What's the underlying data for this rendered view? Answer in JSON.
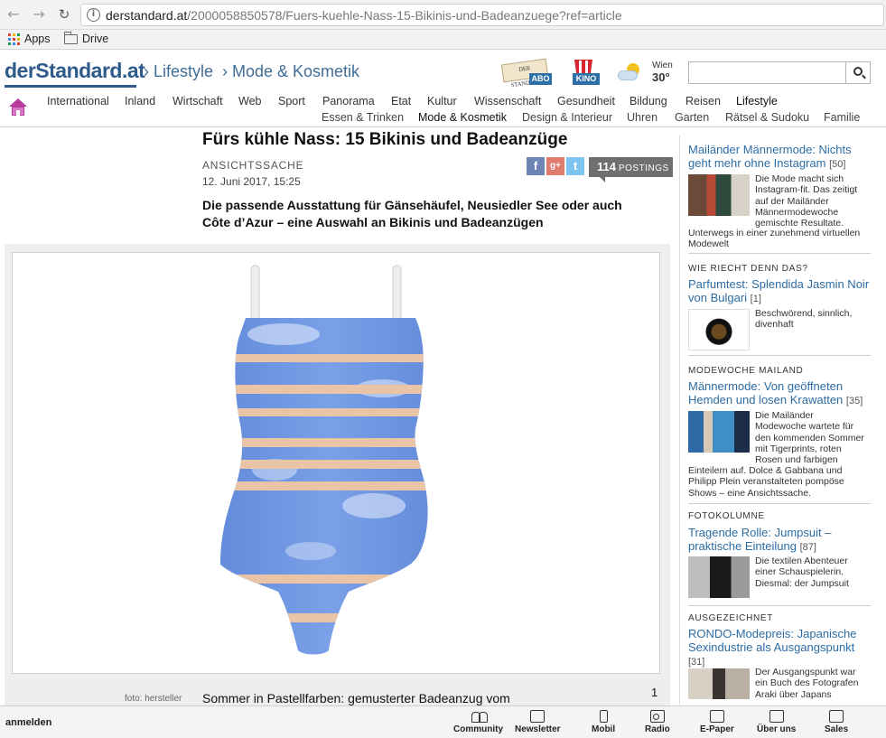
{
  "browser": {
    "url_domain": "derstandard.at",
    "url_path": "/2000058850578/Fuers-kuehle-Nass-15-Bikinis-und-Badeanzuege?ref=article",
    "bookmarks": [
      "Apps",
      "Drive"
    ]
  },
  "header": {
    "logo": "derStandard.at",
    "crumbs": [
      "› Lifestyle",
      "› Mode & Kosmetik"
    ],
    "abo_paper": "DER STANDARD",
    "abo_label": "ABO",
    "kino_label": "KINO",
    "weather_city": "Wien",
    "weather_temp": "30°",
    "search_placeholder": ""
  },
  "nav": {
    "main": [
      "International",
      "Inland",
      "Wirtschaft",
      "Web",
      "Sport",
      "Panorama",
      "Etat",
      "Kultur",
      "Wissenschaft",
      "Gesundheit",
      "Bildung",
      "Reisen",
      "Lifestyle"
    ],
    "sub": [
      "Essen & Trinken",
      "Mode & Kosmetik",
      "Design & Interieur",
      "Uhren",
      "Garten",
      "Rätsel & Sudoku",
      "Familie"
    ]
  },
  "article": {
    "title": "Fürs kühle Nass: 15 Bikinis und Badeanzüge",
    "kicker": "ANSICHTSSACHE",
    "date": "12. Juni 2017, 15:25",
    "postings_count": "114",
    "postings_label": "POSTINGS",
    "share_fb": "f",
    "share_gplus": "g+",
    "share_tw": "t",
    "lead_line1": "Die passende Ausstattung für Gänsehäufel, Neusiedler See oder auch",
    "lead_line2": "Côte d’Azur – eine Auswahl an Bikinis und Badeanzügen",
    "photo_credit": "foto: hersteller",
    "caption": "Sommer in Pastellfarben: gemusterter Badeanzug vom",
    "slide_number": "1"
  },
  "sidebar": [
    {
      "kicker": "",
      "headline": "Mailänder Männermode: Nichts geht mehr ohne Instagram",
      "count": "[50]",
      "text_lines": [
        "Die Mode macht sich",
        "Instagram-fit. Das zeitigt",
        "auf der Mailänder",
        "Männermodewoche",
        "gemischte Resultate.",
        "Unterwegs in einer zunehmend virtuellen",
        "Modewelt"
      ]
    },
    {
      "kicker": "WIE RIECHT DENN DAS?",
      "headline": "Parfumtest: Splendida Jasmin Noir von Bulgari",
      "count": "[1]",
      "text_lines": [
        "Beschwörend, sinnlich,",
        "divenhaft"
      ]
    },
    {
      "kicker": "MODEWOCHE MAILAND",
      "headline": "Männermode: Von geöffneten Hemden und losen Krawatten",
      "count": "[35]",
      "text_lines": [
        "Die Mailänder",
        "Modewoche wartete für",
        "den kommenden Sommer",
        "mit Tigerprints, roten",
        "Rosen und farbigen",
        "Einteilern auf. Dolce & Gabbana und",
        "Philipp Plein veranstalteten pompöse",
        "Shows – eine Ansichtssache."
      ]
    },
    {
      "kicker": "FOTOKOLUMNE",
      "headline": "Tragende Rolle: Jumpsuit – praktische Einteilung",
      "count": "[87]",
      "text_lines": [
        "Die textilen Abenteuer",
        "einer Schauspielerin.",
        "Diesmal: der Jumpsuit"
      ]
    },
    {
      "kicker": "AUSGEZEICHNET",
      "headline": "RONDO-Modepreis: Japanische Sexindustrie als Ausgangspunkt",
      "count": "[31]",
      "text_lines": [
        "Der Ausgangspunkt war",
        "ein Buch des Fotografen",
        "Araki über Japans"
      ]
    }
  ],
  "bottombar": {
    "login": "anmelden",
    "tools": [
      "Community",
      "Newsletter",
      "Mobil",
      "Radio",
      "E-Paper",
      "Über uns",
      "Sales"
    ]
  },
  "colors": {
    "brand_blue": "#2e5b8a",
    "link_blue": "#2c6ca3",
    "swimsuit_blue": "#6f94de",
    "swimsuit_stripe": "#e9c4a6",
    "facebook": "#3b5998",
    "gplus": "#d34836",
    "twitter": "#55acee"
  }
}
